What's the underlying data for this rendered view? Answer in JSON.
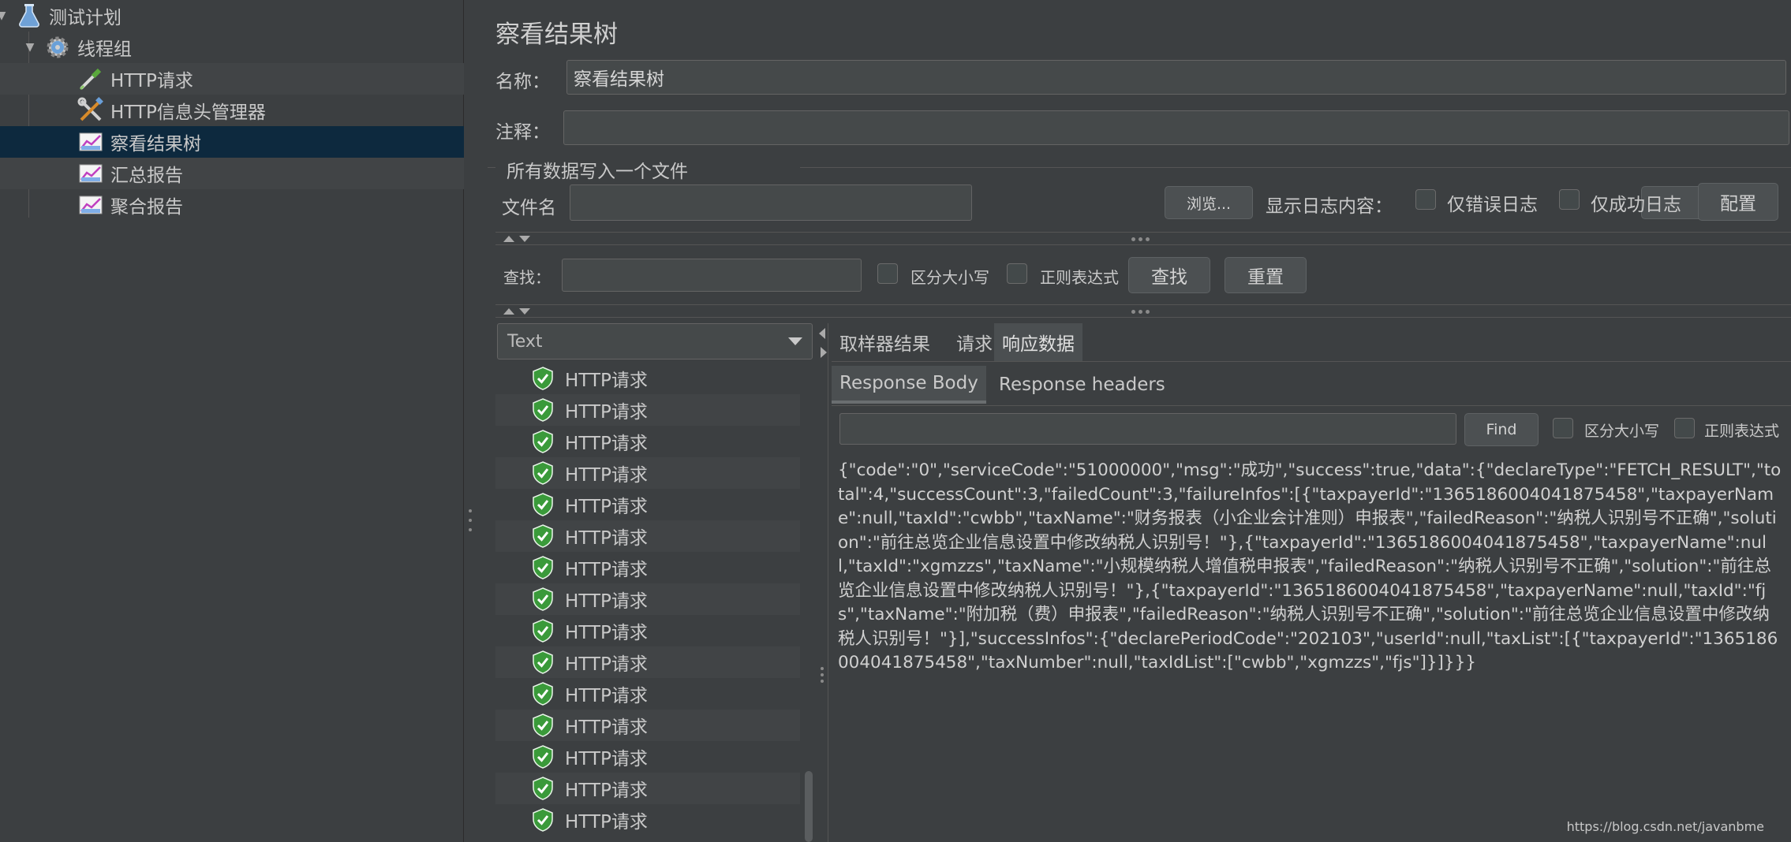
{
  "tree": {
    "items": [
      {
        "label": "测试计划",
        "icon": "flask-icon"
      },
      {
        "label": "线程组",
        "icon": "gear-icon"
      },
      {
        "label": "HTTP请求",
        "icon": "pipette-icon"
      },
      {
        "label": "HTTP信息头管理器",
        "icon": "wrench-icon"
      },
      {
        "label": "察看结果树",
        "icon": "chart-icon"
      },
      {
        "label": "汇总报告",
        "icon": "chart-icon"
      },
      {
        "label": "聚合报告",
        "icon": "chart-icon"
      }
    ]
  },
  "panel": {
    "title": "察看结果树",
    "name_label": "名称：",
    "name_value": "察看结果树",
    "comment_label": "注释：",
    "comment_value": "",
    "file_group_title": "所有数据写入一个文件",
    "filename_label": "文件名",
    "filename_value": "",
    "browse_button": "浏览...",
    "log_content_label": "显示日志内容：",
    "errors_only_label": "仅错误日志",
    "success_only_label": "仅成功日志",
    "configure_button": "配置"
  },
  "search": {
    "label": "查找：",
    "value": "",
    "case_sensitive_label": "区分大小写",
    "regex_label": "正则表达式",
    "find_button": "查找",
    "reset_button": "重置"
  },
  "renderer": {
    "selected": "Text"
  },
  "samples": {
    "label": "HTTP请求",
    "count_visible": 15
  },
  "result_tabs": {
    "sampler_result": "取样器结果",
    "request": "请求",
    "response_data": "响应数据"
  },
  "response_tabs": {
    "body": "Response Body",
    "headers": "Response headers"
  },
  "response_search": {
    "value": "",
    "find_button": "Find",
    "case_sensitive_label": "区分大小写",
    "regex_label": "正则表达式"
  },
  "response_body": "{\"code\":\"0\",\"serviceCode\":\"51000000\",\"msg\":\"成功\",\"success\":true,\"data\":{\"declareType\":\"FETCH_RESULT\",\"total\":4,\"successCount\":3,\"failedCount\":3,\"failureInfos\":[{\"taxpayerId\":\"1365186004041875458\",\"taxpayerName\":null,\"taxId\":\"cwbb\",\"taxName\":\"财务报表（小企业会计准则）申报表\",\"failedReason\":\"纳税人识别号不正确\",\"solution\":\"前往总览企业信息设置中修改纳税人识别号！\"},{\"taxpayerId\":\"1365186004041875458\",\"taxpayerName\":null,\"taxId\":\"xgmzzs\",\"taxName\":\"小规模纳税人增值税申报表\",\"failedReason\":\"纳税人识别号不正确\",\"solution\":\"前往总览企业信息设置中修改纳税人识别号！\"},{\"taxpayerId\":\"1365186004041875458\",\"taxpayerName\":null,\"taxId\":\"fjs\",\"taxName\":\"附加税（费）申报表\",\"failedReason\":\"纳税人识别号不正确\",\"solution\":\"前往总览企业信息设置中修改纳税人识别号！\"}],\"successInfos\":{\"declarePeriodCode\":\"202103\",\"userId\":null,\"taxList\":[{\"taxpayerId\":\"1365186004041875458\",\"taxNumber\":null,\"taxIdList\":[\"cwbb\",\"xgmzzs\",\"fjs\"]}]}}}",
  "watermark": "https://blog.csdn.net/javanbme",
  "colors": {
    "background": "#3c3f41",
    "selected_row": "#0d293e",
    "success_shield": "#3a9a3a"
  }
}
